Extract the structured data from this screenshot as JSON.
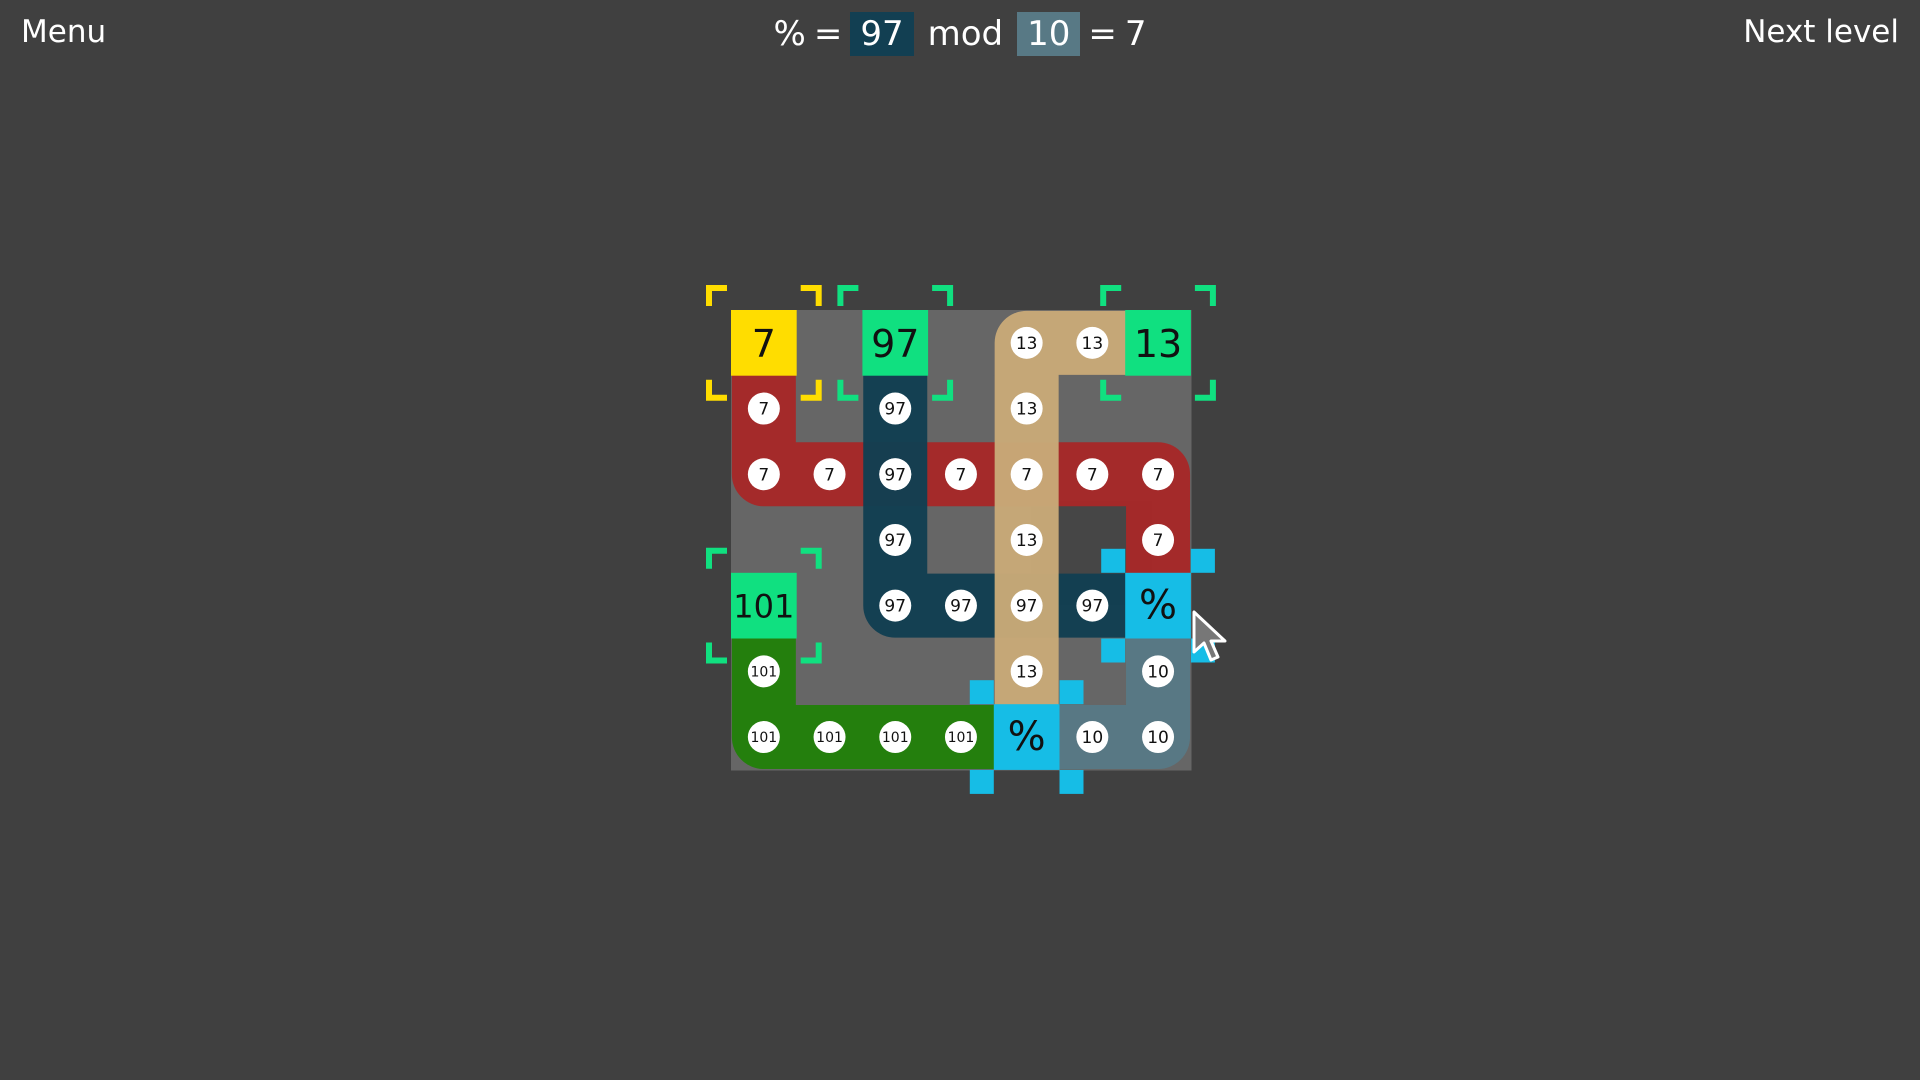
{
  "header": {
    "menu_label": "Menu",
    "next_label": "Next level",
    "formula": {
      "result_symbol": "%",
      "eq1": "=",
      "left_operand": "97",
      "operator": "mod",
      "right_operand": "10",
      "eq2": "=",
      "result": "7"
    }
  },
  "board": {
    "grid_rows": 7,
    "grid_cols": 7,
    "sources": [
      {
        "label": "7",
        "row": 0,
        "col": 0,
        "color": "#ffdd00",
        "selected": true
      },
      {
        "label": "97",
        "row": 0,
        "col": 2,
        "color": "#10e080"
      },
      {
        "label": "13",
        "row": 0,
        "col": 6,
        "color": "#10e080"
      },
      {
        "label": "101",
        "row": 4,
        "col": 0,
        "color": "#10e080"
      }
    ],
    "operators": [
      {
        "label": "%",
        "row": 4,
        "col": 6,
        "color": "#16bde6",
        "active": true
      },
      {
        "label": "%",
        "row": 6,
        "col": 4,
        "color": "#16bde6"
      }
    ],
    "paths": [
      {
        "name": "path-7",
        "value": "7",
        "color": "#a62828",
        "cells": [
          [
            0,
            0
          ],
          [
            1,
            0
          ],
          [
            2,
            0
          ],
          [
            2,
            1
          ],
          [
            2,
            2
          ],
          [
            2,
            3
          ],
          [
            2,
            4
          ],
          [
            2,
            5
          ],
          [
            2,
            6
          ],
          [
            3,
            6
          ],
          [
            4,
            6
          ]
        ],
        "markers": [
          [
            1,
            0
          ],
          [
            2,
            0
          ],
          [
            2,
            1
          ],
          [
            2,
            2
          ],
          [
            2,
            3
          ],
          [
            2,
            4
          ],
          [
            2,
            5
          ],
          [
            2,
            6
          ],
          [
            3,
            6
          ]
        ]
      },
      {
        "name": "path-97",
        "value": "97",
        "color": "#123f52",
        "cells": [
          [
            0,
            2
          ],
          [
            1,
            2
          ],
          [
            2,
            2
          ],
          [
            3,
            2
          ],
          [
            4,
            2
          ],
          [
            4,
            3
          ],
          [
            4,
            4
          ],
          [
            4,
            5
          ],
          [
            4,
            6
          ]
        ],
        "markers": [
          [
            1,
            2
          ],
          [
            2,
            2
          ],
          [
            3,
            2
          ],
          [
            4,
            2
          ],
          [
            4,
            3
          ],
          [
            4,
            4
          ],
          [
            4,
            5
          ]
        ]
      },
      {
        "name": "path-13",
        "value": "13",
        "color": "#c8a978",
        "cells": [
          [
            0,
            6
          ],
          [
            0,
            5
          ],
          [
            0,
            4
          ],
          [
            1,
            4
          ],
          [
            2,
            4
          ],
          [
            3,
            4
          ],
          [
            4,
            4
          ],
          [
            5,
            4
          ],
          [
            6,
            4
          ]
        ],
        "markers": [
          [
            0,
            5
          ],
          [
            0,
            4
          ],
          [
            1,
            4
          ],
          [
            3,
            4
          ],
          [
            5,
            4
          ]
        ]
      },
      {
        "name": "path-101",
        "value": "101",
        "color": "#22800a",
        "cells": [
          [
            4,
            0
          ],
          [
            5,
            0
          ],
          [
            6,
            0
          ],
          [
            6,
            1
          ],
          [
            6,
            2
          ],
          [
            6,
            3
          ],
          [
            6,
            4
          ]
        ],
        "markers": [
          [
            5,
            0
          ],
          [
            6,
            0
          ],
          [
            6,
            1
          ],
          [
            6,
            2
          ],
          [
            6,
            3
          ]
        ]
      },
      {
        "name": "path-10",
        "value": "10",
        "color": "#587985",
        "cells": [
          [
            6,
            4
          ],
          [
            6,
            5
          ],
          [
            6,
            6
          ],
          [
            5,
            6
          ],
          [
            4,
            6
          ]
        ],
        "markers": [
          [
            6,
            5
          ],
          [
            6,
            6
          ],
          [
            5,
            6
          ]
        ]
      }
    ],
    "colors": {
      "empty_cell": "#666666",
      "background": "#404040",
      "marker_fill": "#ffffff",
      "marker_text": "#111111",
      "corner_green": "#10e080",
      "corner_yellow": "#ffdd00",
      "corner_cyan": "#16bde6"
    }
  }
}
